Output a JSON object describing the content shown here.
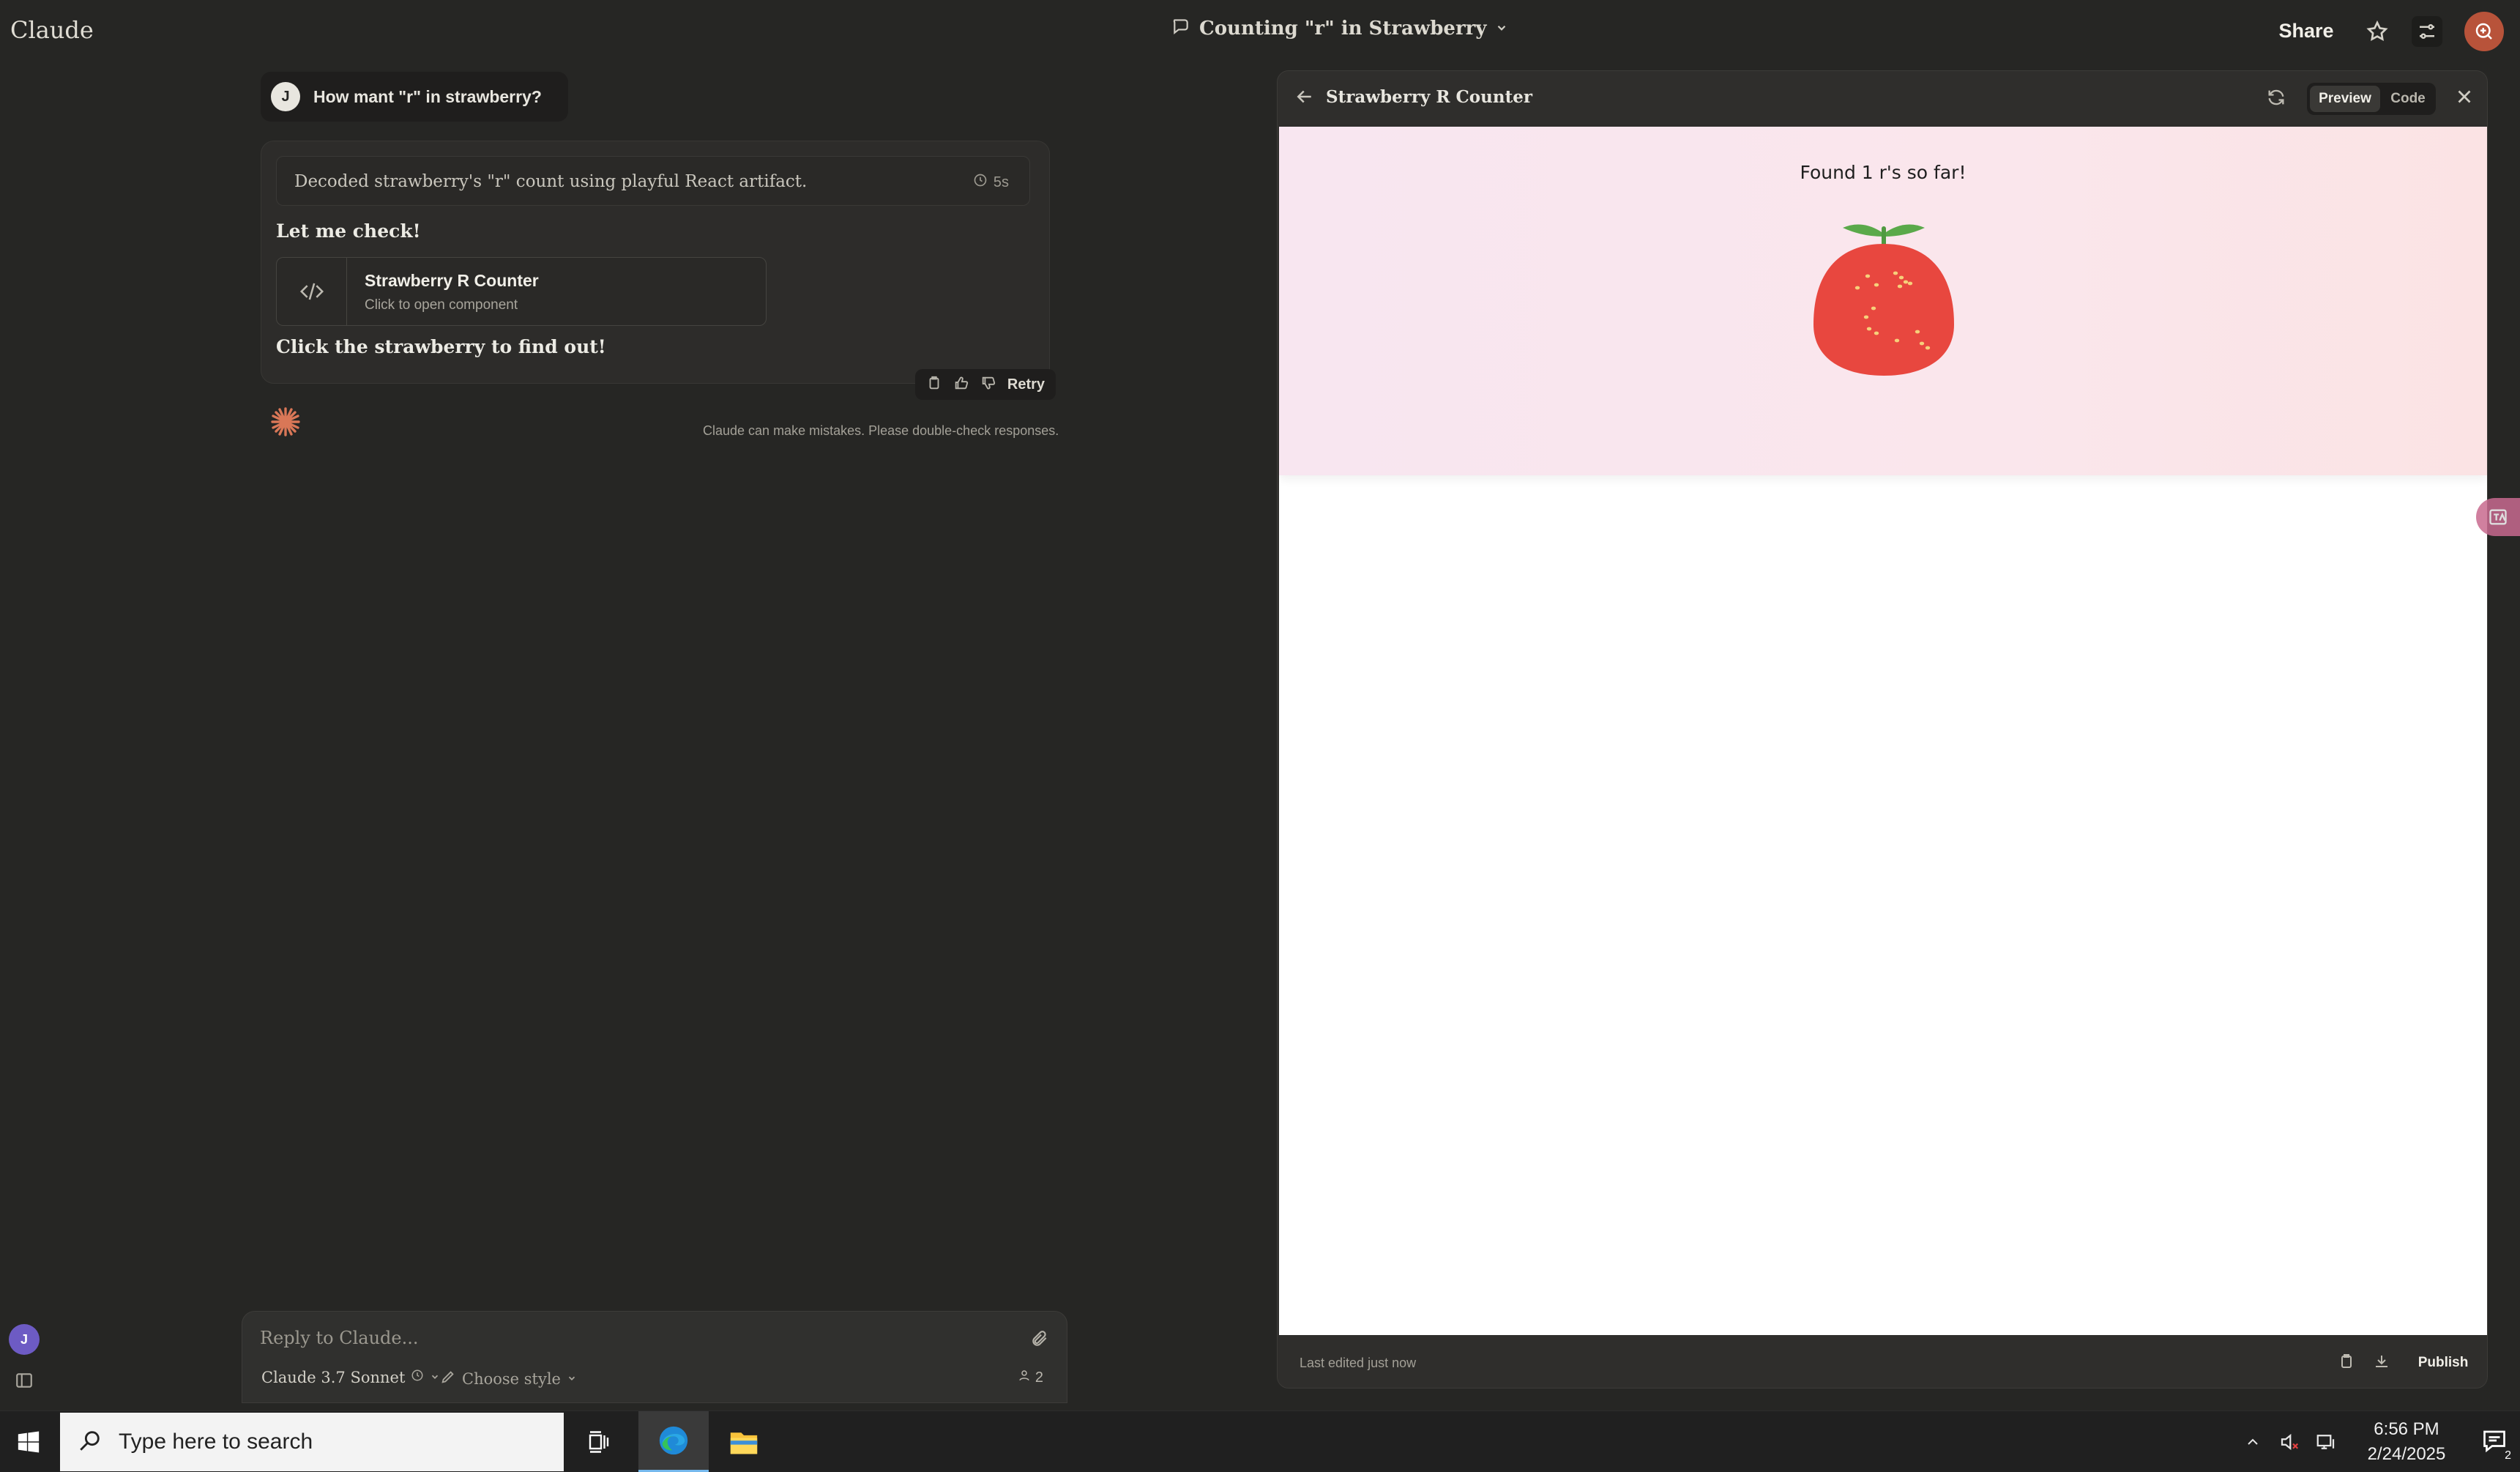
{
  "app": {
    "title": "Claude"
  },
  "header": {
    "conversation_title": "Counting \"r\" in Strawberry",
    "share_label": "Share"
  },
  "chat": {
    "user_initial": "J",
    "user_message": "How mant \"r\" in strawberry?",
    "thinking_summary": "Decoded strawberry's \"r\" count using playful React artifact.",
    "thinking_time": "5s",
    "intro": "Let me check!",
    "artifact_card": {
      "name": "Strawberry R Counter",
      "subtitle": "Click to open component"
    },
    "outro": "Click the strawberry to find out!",
    "retry_label": "Retry",
    "disclaimer": "Claude can make mistakes. Please double-check responses."
  },
  "composer": {
    "placeholder": "Reply to Claude...",
    "model": "Claude 3.7 Sonnet",
    "style": "Choose style",
    "count": "2"
  },
  "artifact_panel": {
    "title": "Strawberry R Counter",
    "tabs": [
      {
        "label": "Preview",
        "active": true
      },
      {
        "label": "Code",
        "active": false
      }
    ],
    "preview": {
      "found_text": "Found 1 r's so far!"
    },
    "last_edited": "Last edited just now",
    "publish_label": "Publish"
  },
  "taskbar": {
    "search_placeholder": "Type here to search",
    "time": "6:56 PM",
    "date": "2/24/2025",
    "notification_count": "2"
  },
  "colors": {
    "background": "#262624",
    "accent": "#d97757",
    "strawberry": "#e8473f",
    "leaf": "#5aa94a"
  }
}
